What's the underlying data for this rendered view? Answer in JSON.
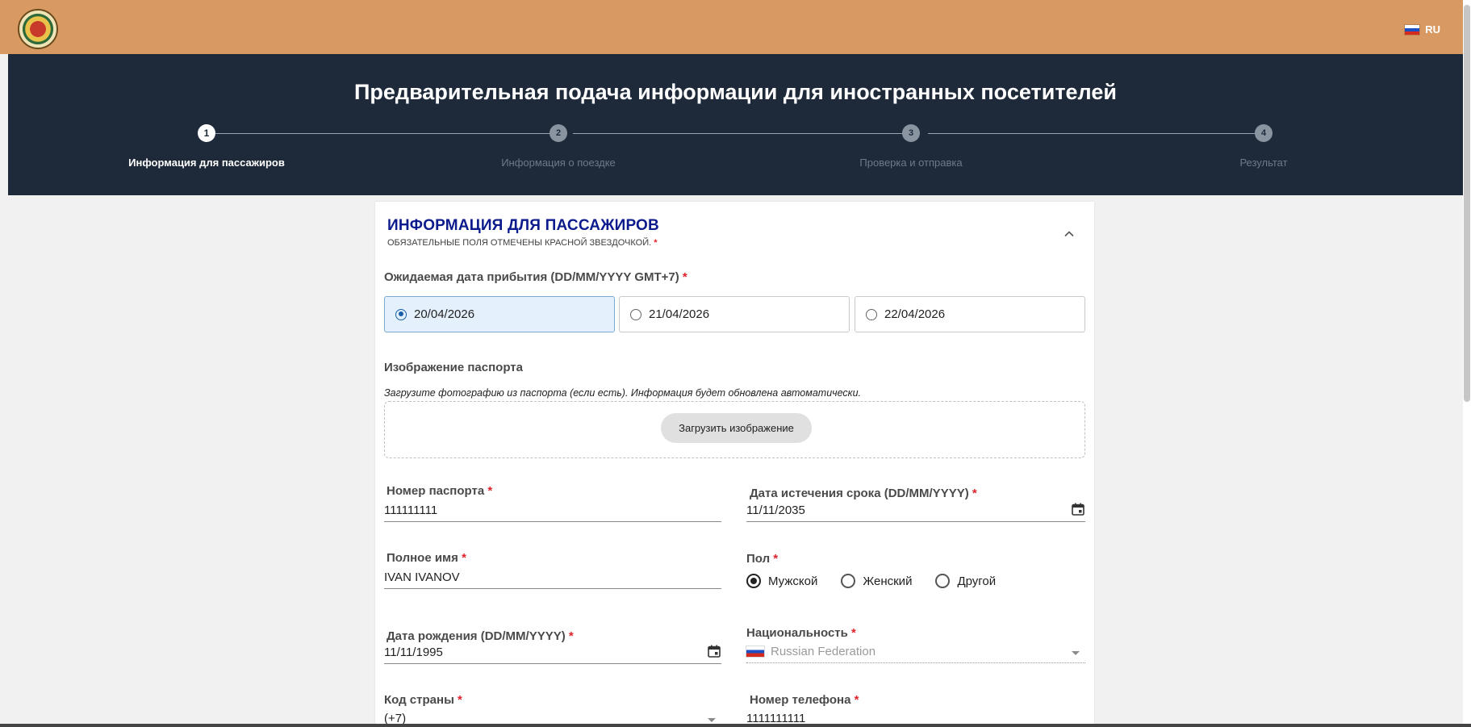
{
  "topbar": {
    "language": "RU",
    "logo_icon": "emblem-logo"
  },
  "header": {
    "title": "Предварительная подача информации для иностранных посетителей",
    "steps": [
      {
        "number": "1",
        "label": "Информация для пассажиров"
      },
      {
        "number": "2",
        "label": "Информация о поездке"
      },
      {
        "number": "3",
        "label": "Проверка и отправка"
      },
      {
        "number": "4",
        "label": "Результат"
      }
    ],
    "active_step": 1
  },
  "card": {
    "title": "ИНФОРМАЦИЯ ДЛЯ ПАССАЖИРОВ",
    "subtitle": "ОБЯЗАТЕЛЬНЫЕ ПОЛЯ ОТМЕЧЕНЫ КРАСНОЙ ЗВЕЗДОЧКОЙ.",
    "required_mark": "*",
    "collapse_icon": "chevron-up-icon"
  },
  "arrival": {
    "label": "Ожидаемая дата прибытия (DD/MM/YYYY GMT+7)",
    "options": [
      "20/04/2026",
      "21/04/2026",
      "22/04/2026"
    ],
    "selected": "20/04/2026"
  },
  "passport_image": {
    "label": "Изображение паспорта",
    "hint": "Загрузите фотографию из паспорта (если есть). Информация будет обновлена автоматически.",
    "upload_button": "Загрузить изображение"
  },
  "fields": {
    "passport_number": {
      "label": "Номер паспорта",
      "value": "111111111"
    },
    "expiry_date": {
      "label": "Дата истечения срока (DD/MM/YYYY)",
      "value": "11/11/2035"
    },
    "full_name": {
      "label": "Полное имя",
      "value": "IVAN IVANOV"
    },
    "gender": {
      "label": "Пол",
      "options": [
        "Мужской",
        "Женский",
        "Другой"
      ],
      "selected": "Мужской"
    },
    "birth_date": {
      "label": "Дата рождения (DD/MM/YYYY)",
      "value": "11/11/1995"
    },
    "nationality": {
      "label": "Национальность",
      "value": "Russian Federation"
    },
    "country_code": {
      "label": "Код страны",
      "value": "(+7)"
    },
    "phone": {
      "label": "Номер телефона",
      "value": "1111111111"
    }
  },
  "colors": {
    "topbar": "#d89a62",
    "header": "#1e2a3a",
    "card_title": "#0b1a8c",
    "required": "#e0222a",
    "selected_option_bg": "#e4f1fd"
  }
}
